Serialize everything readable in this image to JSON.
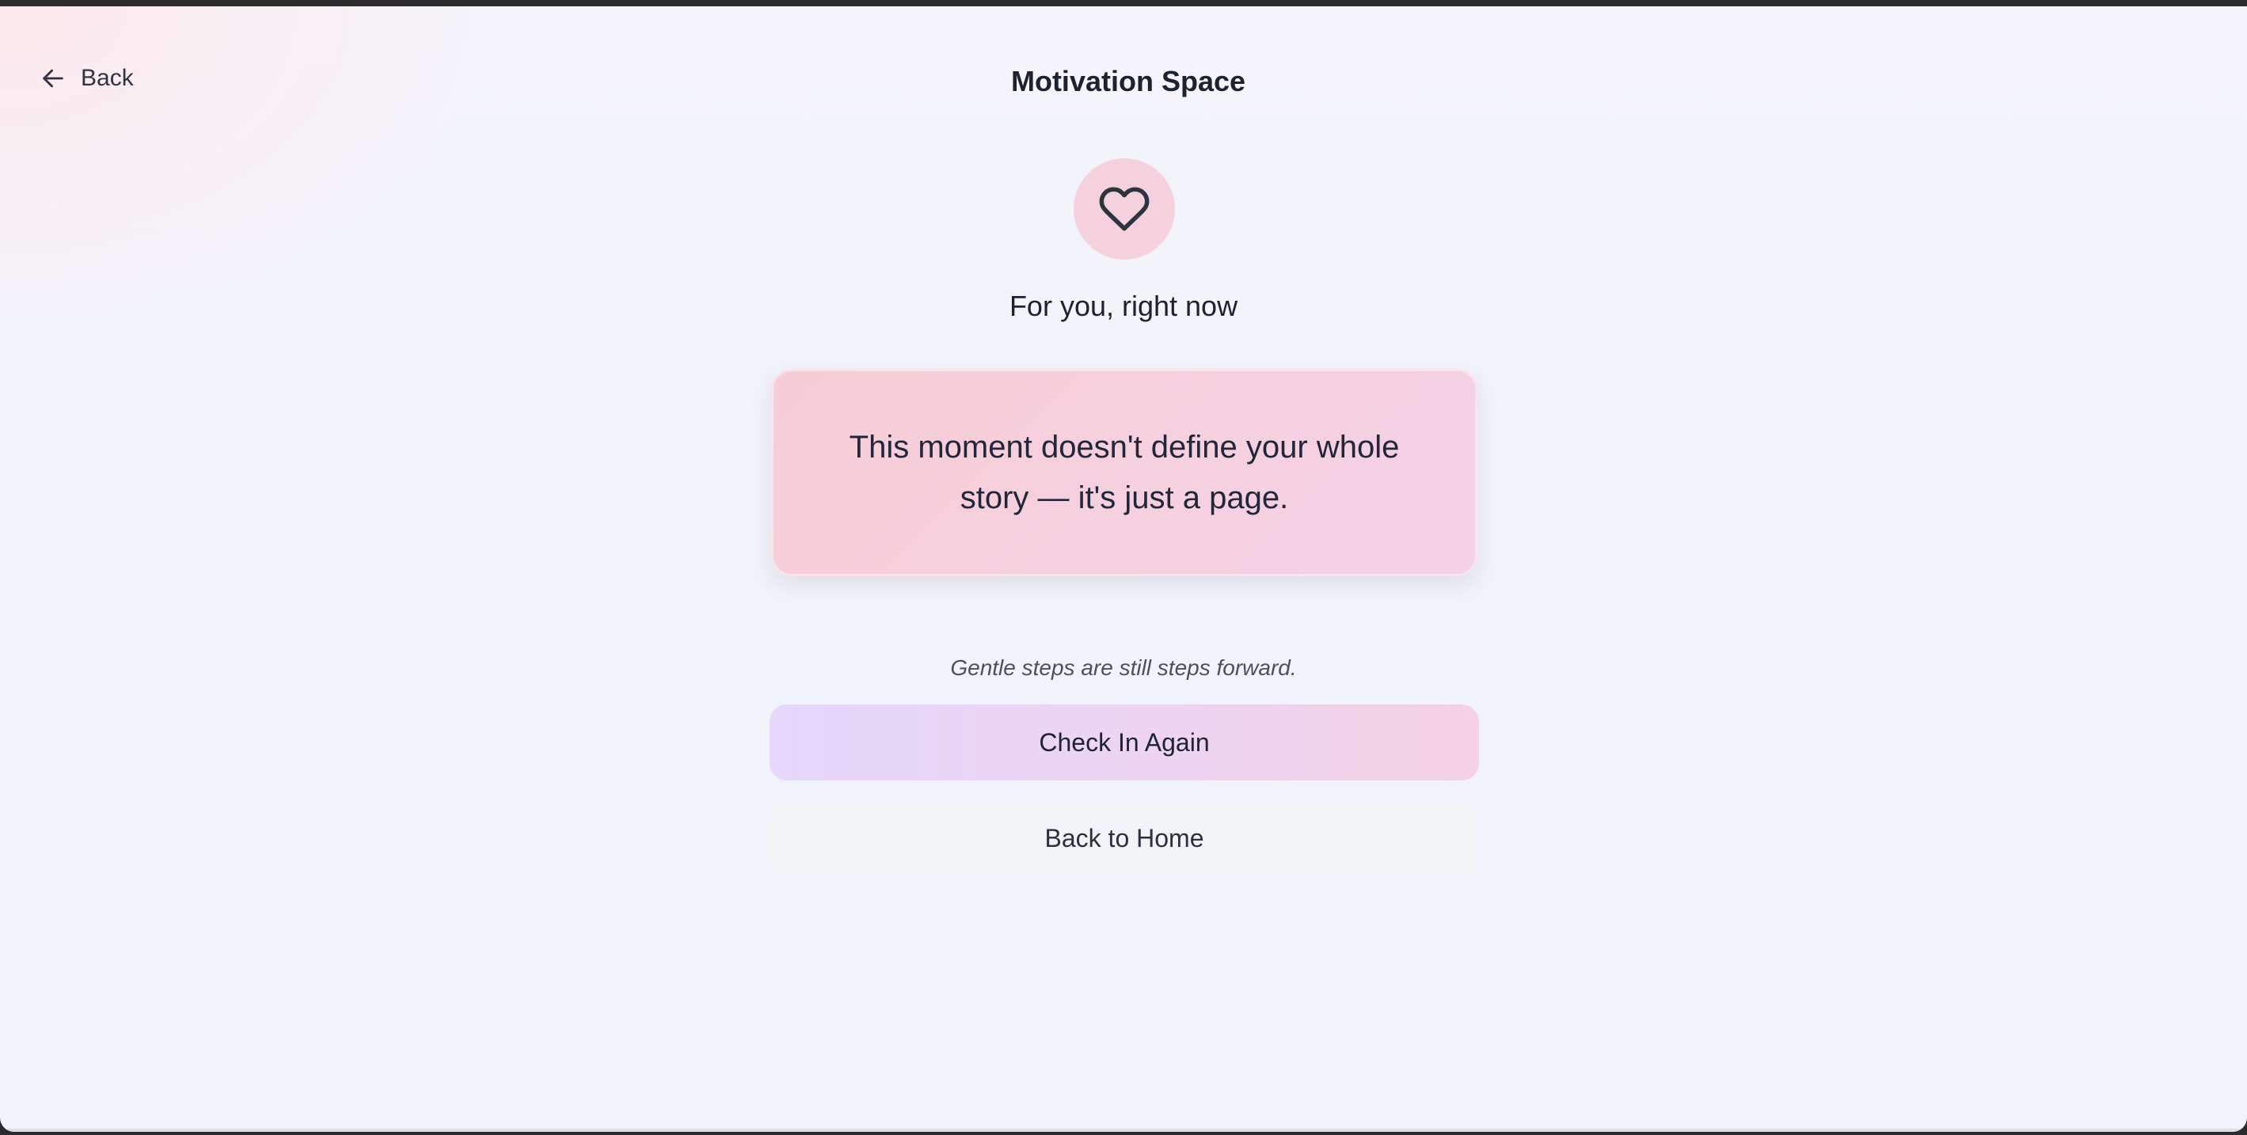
{
  "header": {
    "back_label": "Back",
    "title": "Motivation Space"
  },
  "hero": {
    "icon": "heart-icon",
    "subtitle": "For you, right now"
  },
  "quote": {
    "text": "This moment doesn't define your whole story — it's just a page."
  },
  "footer": {
    "hint": "Gentle steps are still steps forward.",
    "primary_button_label": "Check In Again",
    "secondary_button_label": "Back to Home"
  },
  "colors": {
    "icon_circle": "#f4d1dc",
    "quote_card": "#f6cdd6",
    "primary_button_start": "#e6d7fb",
    "primary_button_end": "#f4d1e4",
    "secondary_button": "#f2f3f6",
    "text": "#1d2230"
  }
}
